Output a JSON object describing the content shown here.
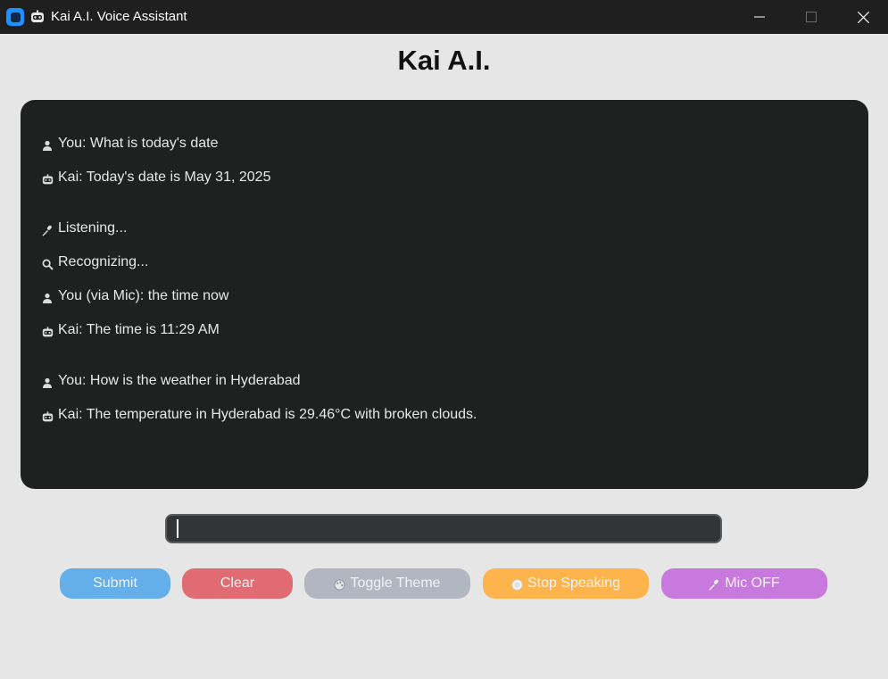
{
  "window": {
    "title": "Kai A.I. Voice Assistant"
  },
  "header": {
    "title": "Kai A.I."
  },
  "chat": {
    "messages": [
      {
        "icon": "user-icon",
        "text": "You: What is today's date"
      },
      {
        "icon": "robot-icon",
        "text": "Kai: Today's date is May 31, 2025"
      },
      {
        "icon": "microphone-icon",
        "text": "Listening..."
      },
      {
        "icon": "magnifier-icon",
        "text": "Recognizing..."
      },
      {
        "icon": "user-icon",
        "text": "You (via Mic): the time now"
      },
      {
        "icon": "robot-icon",
        "text": "Kai: The time is 11:29 AM"
      },
      {
        "icon": "user-icon",
        "text": "You: How is the weather in Hyderabad"
      },
      {
        "icon": "robot-icon",
        "text": "Kai: The temperature in Hyderabad is 29.46°C with broken clouds."
      }
    ]
  },
  "input": {
    "value": "",
    "placeholder": ""
  },
  "buttons": {
    "submit": "Submit",
    "clear": "Clear",
    "toggle_theme": "Toggle Theme",
    "stop_speaking": "Stop Speaking",
    "mic": "Mic OFF"
  },
  "colors": {
    "background": "#e6e6e6",
    "chat_panel": "#1f2020",
    "submit": "#64aeea",
    "clear": "#e06b72",
    "toggle_theme": "#b1b6c1",
    "stop_speaking": "#fdb44d",
    "mic": "#c879dd"
  }
}
